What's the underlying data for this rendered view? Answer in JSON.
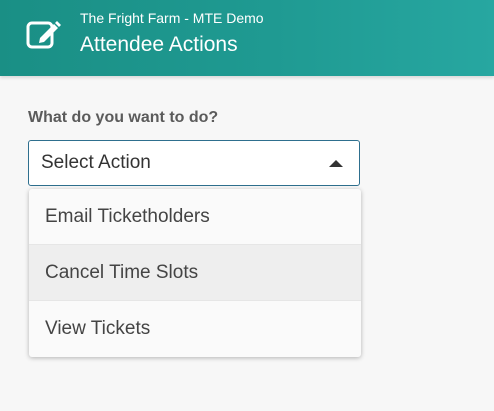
{
  "header": {
    "icon": "edit-icon",
    "subtitle": "The Fright Farm - MTE Demo",
    "title": "Attendee Actions",
    "color": "#1f9a92"
  },
  "form": {
    "question": "What do you want to do?",
    "select": {
      "value": "Select Action",
      "expanded": true,
      "caret_icon": "caret-up-icon",
      "border_color": "#2e6f8e"
    },
    "options": [
      {
        "label": "Email Ticketholders",
        "highlighted": false
      },
      {
        "label": "Cancel Time Slots",
        "highlighted": true
      },
      {
        "label": "View Tickets",
        "highlighted": false
      }
    ]
  }
}
